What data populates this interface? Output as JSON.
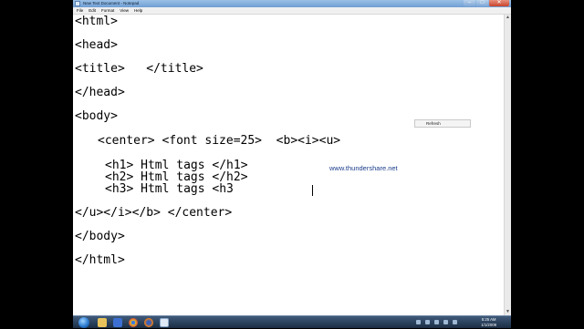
{
  "window": {
    "title": "New Text Document - Notepad",
    "buttons": [
      "–",
      "□",
      "✕"
    ]
  },
  "menu": [
    "File",
    "Edit",
    "Format",
    "View",
    "Help"
  ],
  "editor": {
    "lines": [
      "<html>",
      "<head>",
      "<title>   </title>",
      "</head>",
      "<body>",
      "<center> <font size=25>  <b><i><u>",
      "<h1> Html tags </h1>",
      "<h2> Html tags </h2>",
      "<h3> Html tags <h3",
      "</u></i></b> </center>",
      "</body>",
      "</html>"
    ]
  },
  "watermark": "www.thundershare.net",
  "tooltip": "Refresh",
  "taskbar": {
    "apps": [
      "explorer-icon",
      "media-player-icon",
      "chrome-icon",
      "firefox-icon",
      "notepad-icon"
    ],
    "clock": {
      "time": "5:25 AM",
      "date": "1/1/2009"
    }
  },
  "colors": {
    "titlebar": "#7eaadb",
    "taskbar": "#2a3f5a",
    "watermark": "#1a3c8a"
  }
}
